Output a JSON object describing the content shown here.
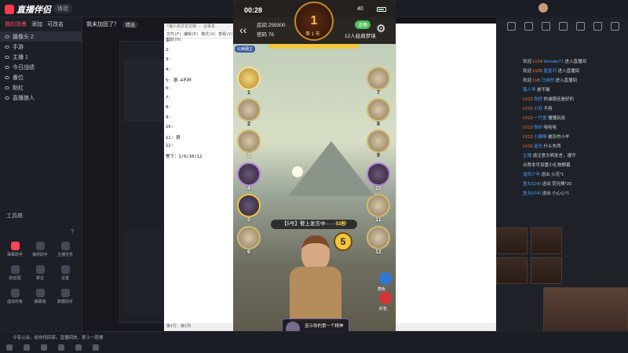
{
  "app": {
    "name": "直播伴侣",
    "version": "体验",
    "window_controls": [
      "—",
      "□",
      "✕"
    ]
  },
  "scene_panel": {
    "tabs": [
      "我的场景",
      "添加",
      "可改名"
    ],
    "active_tab": 0,
    "items": [
      {
        "label": "摄像头 2"
      },
      {
        "label": "手游"
      },
      {
        "label": "主播 1"
      },
      {
        "label": "今日战绩"
      },
      {
        "label": "番位"
      },
      {
        "label": "助红"
      },
      {
        "label": "直播狼人"
      }
    ],
    "tools_title": "工具箱",
    "tools": [
      {
        "label": "弹幕助手",
        "icon": "danmaku-icon",
        "active": true
      },
      {
        "label": "抽奖助手",
        "icon": "lottery-icon"
      },
      {
        "label": "主播任务",
        "icon": "task-icon"
      },
      {
        "label": "粉丝团",
        "icon": "fans-icon"
      },
      {
        "label": "禁言",
        "icon": "mute-icon"
      },
      {
        "label": "设置",
        "icon": "settings-icon"
      },
      {
        "label": "虚拟形象",
        "icon": "avatar-icon"
      },
      {
        "label": "弹幕墙",
        "icon": "wall-icon"
      },
      {
        "label": "数据助手",
        "icon": "data-icon"
      }
    ]
  },
  "mid_app": {
    "title": "我未加固了？",
    "tag": "精选"
  },
  "notepad": {
    "title": "*狼人杀文本文档 - 记事本",
    "menu": "文件(F) 编辑(E) 格式(O) 查看(V) 帮助(H)",
    "lines": [
      "1:",
      "2:",
      "3:",
      "4:",
      "5:  狼-4不杯",
      "6:",
      "7:",
      "8:",
      "9:",
      "10:",
      "11:  狼",
      "12:",
      "警下：2/6/10/12"
    ],
    "status": "第1行，第1列"
  },
  "phone": {
    "time": "00:28",
    "signal": "40",
    "room_label": "房间 259300",
    "password_label": "密码 76",
    "day_number": "1",
    "day_text": "第 1 天",
    "mode": "12人经典梦境",
    "sheriff_pill": "流畅",
    "announcement_tag": "北美圈主",
    "speak_prefix": "【5号】警上发言中······",
    "speak_seconds": "53秒",
    "timer_value": "5",
    "roles_label": "角色",
    "red_label": "红包",
    "card_text": "显示你的第一个精神",
    "seats_left": [
      "1",
      "2",
      "3",
      "4",
      "5",
      "6"
    ],
    "seats_right": [
      "7",
      "8",
      "9",
      "10",
      "11",
      "12"
    ]
  },
  "chat": {
    "messages": [
      {
        "prefix": "欢迎",
        "level": "LV14",
        "name": "Wonder71",
        "text": "进入直播间"
      },
      {
        "prefix": "欢迎",
        "level": "LV20",
        "name": "星星闪",
        "text": "进入直播间"
      },
      {
        "prefix": "欢迎",
        "level": "LV8",
        "name": "马自你",
        "text": "进入直播间"
      },
      {
        "prefix": "",
        "level": "",
        "name": "路人甲",
        "text": "是不猫"
      },
      {
        "prefix": "",
        "level": "LV13",
        "name": "你好",
        "text": "你诚狼还是好的"
      },
      {
        "prefix": "",
        "level": "LV13",
        "name": "小苏",
        "text": "不用"
      },
      {
        "prefix": "",
        "level": "LV13",
        "name": "一只鱼",
        "text": "懂懂玩说"
      },
      {
        "prefix": "",
        "level": "LV13",
        "name": "你好",
        "text": "哈哈哈"
      },
      {
        "prefix": "",
        "level": "LV13",
        "name": "小猫咪",
        "text": "被杀的小羊"
      },
      {
        "prefix": "",
        "level": "LV13",
        "name": "追光",
        "text": "什么东西"
      },
      {
        "prefix": "",
        "level": "",
        "name": "主播",
        "text": "请注意文明发言，遵守"
      },
      {
        "prefix": "",
        "level": "",
        "name": "",
        "text": "点赞本可设置小礼物屏幕"
      },
      {
        "prefix": "",
        "level": "",
        "name": "追风少年",
        "text": "送出 火花*1"
      },
      {
        "prefix": "",
        "level": "",
        "name": "鱼丸5240",
        "text": "送出 荧光棒*20"
      },
      {
        "prefix": "",
        "level": "",
        "name": "鱼丸5240",
        "text": "送出 小心心*1"
      }
    ]
  },
  "bottom": {
    "text": "今有公会，给你找回家。直播回放，更上一层楼"
  },
  "colors": {
    "accent": "#ff3a4e",
    "gold": "#f2c63d",
    "chat_level": "#ff7a3d",
    "chat_name": "#3fa6ff"
  }
}
